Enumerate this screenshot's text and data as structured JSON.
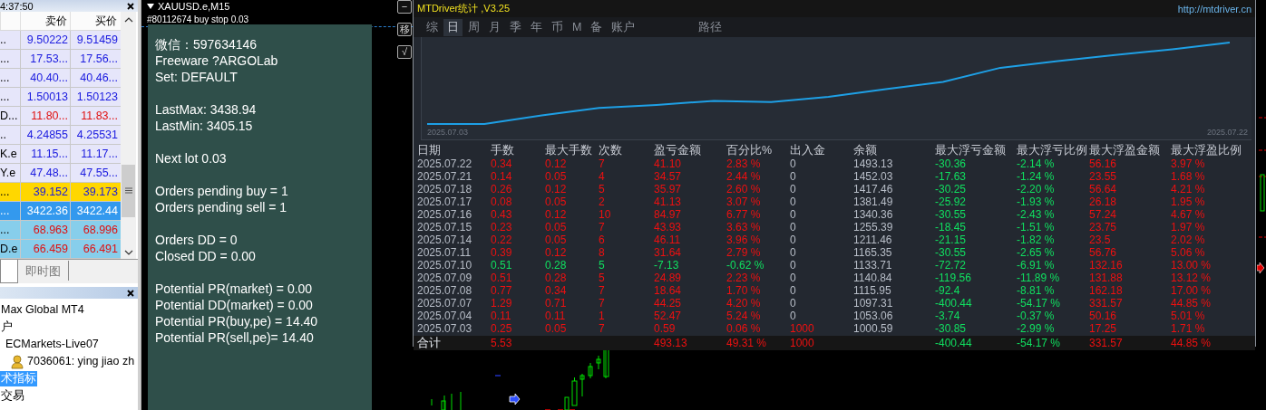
{
  "market_watch": {
    "time": "4:37:50",
    "columns": [
      "卖价",
      "买价"
    ],
    "rows": [
      {
        "symbol": "..",
        "bid": "9.50222",
        "ask": "9.51459",
        "falling": false,
        "color": "#e6e6fa",
        "selected": false
      },
      {
        "symbol": "...",
        "bid": "17.53...",
        "ask": "17.56...",
        "falling": false,
        "color": "#e6e6fa",
        "selected": false
      },
      {
        "symbol": "...",
        "bid": "40.40...",
        "ask": "40.46...",
        "falling": false,
        "color": "#e6e6fa",
        "selected": false
      },
      {
        "symbol": "...",
        "bid": "1.50013",
        "ask": "1.50123",
        "falling": false,
        "color": "#e6e6fa",
        "selected": false
      },
      {
        "symbol": "D...",
        "bid": "11.80...",
        "ask": "11.83...",
        "falling": true,
        "color": "#e6e6fa",
        "selected": false
      },
      {
        "symbol": "..",
        "bid": "4.24855",
        "ask": "4.25531",
        "falling": false,
        "color": "#e6e6fa",
        "selected": false
      },
      {
        "symbol": "K.e",
        "bid": "11.15...",
        "ask": "11.17...",
        "falling": false,
        "color": "#e6e6fa",
        "selected": false
      },
      {
        "symbol": "Y.e",
        "bid": "47.48...",
        "ask": "47.55...",
        "falling": false,
        "color": "#e6e6fa",
        "selected": false
      },
      {
        "symbol": "...",
        "bid": "39.152",
        "ask": "39.173",
        "falling": false,
        "color": "#ffd700",
        "selected": false
      },
      {
        "symbol": "...",
        "bid": "3422.36",
        "ask": "3422.44",
        "falling": false,
        "selected": true
      },
      {
        "symbol": "...",
        "bid": "68.963",
        "ask": "68.996",
        "falling": true,
        "color": "#87ceeb",
        "selected": false
      },
      {
        "symbol": "D.e",
        "bid": "66.459",
        "ask": "66.491",
        "falling": true,
        "color": "#87ceeb",
        "selected": false
      }
    ],
    "tabs": [
      {
        "label": "即时图",
        "selected": false
      }
    ]
  },
  "navigator": {
    "items": [
      {
        "label": "Max Global MT4",
        "selected": false
      },
      {
        "label": "户",
        "selected": false,
        "children": [
          {
            "label": "ECMarkets-Live07",
            "selected": false,
            "children": [
              {
                "label": "7036061: ying jiao zh",
                "kind": "account",
                "selected": false
              }
            ]
          }
        ]
      },
      {
        "label": "术指标",
        "selected": true
      },
      {
        "label": "交易",
        "selected": false
      }
    ]
  },
  "chart": {
    "title": "XAUUSD.e,M15",
    "order_label": "#80112674 buy stop 0.03",
    "side_buttons": [
      "−",
      "移",
      "√"
    ]
  },
  "info_panel": {
    "groups": [
      [
        "微信：597634146",
        "Freeware ?ARGOLab",
        "Set: DEFAULT"
      ],
      [
        "LastMax: 3438.94",
        "LastMin: 3405.15"
      ],
      [
        "Next lot 0.03"
      ],
      [
        "Orders pending buy =  1",
        "Orders pending sell = 1"
      ],
      [
        "Orders DD = 0",
        "Closed DD = 0.00"
      ],
      [
        "Potential PR(market) = 0.00",
        "Potential DD(market) = 0.00",
        "Potential PR(buy,pe) = 14.40",
        "Potential PR(sell,pe)= 14.40"
      ]
    ]
  },
  "stats": {
    "title": "MTDriver统计 ,V3.25",
    "link": "http://mtdriver.cn",
    "tabs": [
      {
        "label": "综",
        "selected": false
      },
      {
        "label": "日",
        "selected": true
      },
      {
        "label": "周",
        "selected": false
      },
      {
        "label": "月",
        "selected": false
      },
      {
        "label": "季",
        "selected": false
      },
      {
        "label": "年",
        "selected": false
      },
      {
        "label": "币",
        "selected": false
      },
      {
        "label": "M",
        "selected": false
      },
      {
        "label": "备",
        "selected": false
      },
      {
        "label": "账户",
        "selected": false
      }
    ],
    "path_tab": "路径",
    "balance_chart": {
      "start_label": "2025.07.03",
      "end_label": "2025.07.22"
    },
    "columns": [
      "日期",
      "手数",
      "最大手数",
      "次数",
      "盈亏金额",
      "百分比%",
      "出入金",
      "余额",
      "最大浮亏金额",
      "最大浮亏比例",
      "最大浮盈金额",
      "最大浮盈比例"
    ],
    "rows": [
      {
        "cells": [
          {
            "text": "2025.07.22",
            "color": "#b8bec8"
          },
          {
            "text": "0.34",
            "color": "#ee1010"
          },
          {
            "text": "0.12",
            "color": "#ee1010"
          },
          {
            "text": "7",
            "color": "#ee1010"
          },
          {
            "text": "41.10",
            "color": "#ee1010"
          },
          {
            "text": "2.83 %",
            "color": "#ee1010"
          },
          {
            "text": "0",
            "color": "#b8bec8"
          },
          {
            "text": "1493.13",
            "color": "#b8bec8"
          },
          {
            "text": "-30.36",
            "color": "#10e060"
          },
          {
            "text": "-2.14 %",
            "color": "#10e060"
          },
          {
            "text": "56.16",
            "color": "#ee1010"
          },
          {
            "text": "3.97 %",
            "color": "#ee1010"
          }
        ]
      },
      {
        "cells": [
          {
            "text": "2025.07.21",
            "color": "#b8bec8"
          },
          {
            "text": "0.14",
            "color": "#ee1010"
          },
          {
            "text": "0.05",
            "color": "#ee1010"
          },
          {
            "text": "4",
            "color": "#ee1010"
          },
          {
            "text": "34.57",
            "color": "#ee1010"
          },
          {
            "text": "2.44 %",
            "color": "#ee1010"
          },
          {
            "text": "0",
            "color": "#b8bec8"
          },
          {
            "text": "1452.03",
            "color": "#b8bec8"
          },
          {
            "text": "-17.63",
            "color": "#10e060"
          },
          {
            "text": "-1.24 %",
            "color": "#10e060"
          },
          {
            "text": "23.55",
            "color": "#ee1010"
          },
          {
            "text": "1.68 %",
            "color": "#ee1010"
          }
        ]
      },
      {
        "cells": [
          {
            "text": "2025.07.18",
            "color": "#b8bec8"
          },
          {
            "text": "0.26",
            "color": "#ee1010"
          },
          {
            "text": "0.12",
            "color": "#ee1010"
          },
          {
            "text": "5",
            "color": "#ee1010"
          },
          {
            "text": "35.97",
            "color": "#ee1010"
          },
          {
            "text": "2.60 %",
            "color": "#ee1010"
          },
          {
            "text": "0",
            "color": "#b8bec8"
          },
          {
            "text": "1417.46",
            "color": "#b8bec8"
          },
          {
            "text": "-30.25",
            "color": "#10e060"
          },
          {
            "text": "-2.20 %",
            "color": "#10e060"
          },
          {
            "text": "56.64",
            "color": "#ee1010"
          },
          {
            "text": "4.21 %",
            "color": "#ee1010"
          }
        ]
      },
      {
        "cells": [
          {
            "text": "2025.07.17",
            "color": "#b8bec8"
          },
          {
            "text": "0.08",
            "color": "#ee1010"
          },
          {
            "text": "0.05",
            "color": "#ee1010"
          },
          {
            "text": "2",
            "color": "#ee1010"
          },
          {
            "text": "41.13",
            "color": "#ee1010"
          },
          {
            "text": "3.07 %",
            "color": "#ee1010"
          },
          {
            "text": "0",
            "color": "#b8bec8"
          },
          {
            "text": "1381.49",
            "color": "#b8bec8"
          },
          {
            "text": "-25.92",
            "color": "#10e060"
          },
          {
            "text": "-1.93 %",
            "color": "#10e060"
          },
          {
            "text": "26.18",
            "color": "#ee1010"
          },
          {
            "text": "1.95 %",
            "color": "#ee1010"
          }
        ]
      },
      {
        "cells": [
          {
            "text": "2025.07.16",
            "color": "#b8bec8"
          },
          {
            "text": "0.43",
            "color": "#ee1010"
          },
          {
            "text": "0.12",
            "color": "#ee1010"
          },
          {
            "text": "10",
            "color": "#ee1010"
          },
          {
            "text": "84.97",
            "color": "#ee1010"
          },
          {
            "text": "6.77 %",
            "color": "#ee1010"
          },
          {
            "text": "0",
            "color": "#b8bec8"
          },
          {
            "text": "1340.36",
            "color": "#b8bec8"
          },
          {
            "text": "-30.55",
            "color": "#10e060"
          },
          {
            "text": "-2.43 %",
            "color": "#10e060"
          },
          {
            "text": "57.24",
            "color": "#ee1010"
          },
          {
            "text": "4.67 %",
            "color": "#ee1010"
          }
        ]
      },
      {
        "cells": [
          {
            "text": "2025.07.15",
            "color": "#b8bec8"
          },
          {
            "text": "0.23",
            "color": "#ee1010"
          },
          {
            "text": "0.05",
            "color": "#ee1010"
          },
          {
            "text": "7",
            "color": "#ee1010"
          },
          {
            "text": "43.93",
            "color": "#ee1010"
          },
          {
            "text": "3.63 %",
            "color": "#ee1010"
          },
          {
            "text": "0",
            "color": "#b8bec8"
          },
          {
            "text": "1255.39",
            "color": "#b8bec8"
          },
          {
            "text": "-18.45",
            "color": "#10e060"
          },
          {
            "text": "-1.51 %",
            "color": "#10e060"
          },
          {
            "text": "23.75",
            "color": "#ee1010"
          },
          {
            "text": "1.97 %",
            "color": "#ee1010"
          }
        ]
      },
      {
        "cells": [
          {
            "text": "2025.07.14",
            "color": "#b8bec8"
          },
          {
            "text": "0.22",
            "color": "#ee1010"
          },
          {
            "text": "0.05",
            "color": "#ee1010"
          },
          {
            "text": "6",
            "color": "#ee1010"
          },
          {
            "text": "46.11",
            "color": "#ee1010"
          },
          {
            "text": "3.96 %",
            "color": "#ee1010"
          },
          {
            "text": "0",
            "color": "#b8bec8"
          },
          {
            "text": "1211.46",
            "color": "#b8bec8"
          },
          {
            "text": "-21.15",
            "color": "#10e060"
          },
          {
            "text": "-1.82 %",
            "color": "#10e060"
          },
          {
            "text": "23.5",
            "color": "#ee1010"
          },
          {
            "text": "2.02 %",
            "color": "#ee1010"
          }
        ]
      },
      {
        "cells": [
          {
            "text": "2025.07.11",
            "color": "#b8bec8"
          },
          {
            "text": "0.39",
            "color": "#ee1010"
          },
          {
            "text": "0.12",
            "color": "#ee1010"
          },
          {
            "text": "8",
            "color": "#ee1010"
          },
          {
            "text": "31.64",
            "color": "#ee1010"
          },
          {
            "text": "2.79 %",
            "color": "#ee1010"
          },
          {
            "text": "0",
            "color": "#b8bec8"
          },
          {
            "text": "1165.35",
            "color": "#b8bec8"
          },
          {
            "text": "-30.55",
            "color": "#10e060"
          },
          {
            "text": "-2.65 %",
            "color": "#10e060"
          },
          {
            "text": "56.76",
            "color": "#ee1010"
          },
          {
            "text": "5.06 %",
            "color": "#ee1010"
          }
        ]
      },
      {
        "cells": [
          {
            "text": "2025.07.10",
            "color": "#b8bec8"
          },
          {
            "text": "0.51",
            "color": "#10e060"
          },
          {
            "text": "0.28",
            "color": "#10e060"
          },
          {
            "text": "5",
            "color": "#10e060"
          },
          {
            "text": "-7.13",
            "color": "#10e060"
          },
          {
            "text": "-0.62 %",
            "color": "#10e060"
          },
          {
            "text": "0",
            "color": "#b8bec8"
          },
          {
            "text": "1133.71",
            "color": "#b8bec8"
          },
          {
            "text": "-72.72",
            "color": "#10e060"
          },
          {
            "text": "-6.91 %",
            "color": "#10e060"
          },
          {
            "text": "132.16",
            "color": "#ee1010"
          },
          {
            "text": "13.00 %",
            "color": "#ee1010"
          }
        ]
      },
      {
        "cells": [
          {
            "text": "2025.07.09",
            "color": "#b8bec8"
          },
          {
            "text": "0.51",
            "color": "#ee1010"
          },
          {
            "text": "0.28",
            "color": "#ee1010"
          },
          {
            "text": "5",
            "color": "#ee1010"
          },
          {
            "text": "24.89",
            "color": "#ee1010"
          },
          {
            "text": "2.23 %",
            "color": "#ee1010"
          },
          {
            "text": "0",
            "color": "#b8bec8"
          },
          {
            "text": "1140.84",
            "color": "#b8bec8"
          },
          {
            "text": "-119.56",
            "color": "#10e060"
          },
          {
            "text": "-11.89 %",
            "color": "#10e060"
          },
          {
            "text": "131.88",
            "color": "#ee1010"
          },
          {
            "text": "13.12 %",
            "color": "#ee1010"
          }
        ]
      },
      {
        "cells": [
          {
            "text": "2025.07.08",
            "color": "#b8bec8"
          },
          {
            "text": "0.77",
            "color": "#ee1010"
          },
          {
            "text": "0.34",
            "color": "#ee1010"
          },
          {
            "text": "7",
            "color": "#ee1010"
          },
          {
            "text": "18.64",
            "color": "#ee1010"
          },
          {
            "text": "1.70 %",
            "color": "#ee1010"
          },
          {
            "text": "0",
            "color": "#b8bec8"
          },
          {
            "text": "1115.95",
            "color": "#b8bec8"
          },
          {
            "text": "-92.4",
            "color": "#10e060"
          },
          {
            "text": "-8.81 %",
            "color": "#10e060"
          },
          {
            "text": "162.18",
            "color": "#ee1010"
          },
          {
            "text": "17.00 %",
            "color": "#ee1010"
          }
        ]
      },
      {
        "cells": [
          {
            "text": "2025.07.07",
            "color": "#b8bec8"
          },
          {
            "text": "1.29",
            "color": "#ee1010"
          },
          {
            "text": "0.71",
            "color": "#ee1010"
          },
          {
            "text": "7",
            "color": "#ee1010"
          },
          {
            "text": "44.25",
            "color": "#ee1010"
          },
          {
            "text": "4.20 %",
            "color": "#ee1010"
          },
          {
            "text": "0",
            "color": "#b8bec8"
          },
          {
            "text": "1097.31",
            "color": "#b8bec8"
          },
          {
            "text": "-400.44",
            "color": "#10e060"
          },
          {
            "text": "-54.17 %",
            "color": "#10e060"
          },
          {
            "text": "331.57",
            "color": "#ee1010"
          },
          {
            "text": "44.85 %",
            "color": "#ee1010"
          }
        ]
      },
      {
        "cells": [
          {
            "text": "2025.07.04",
            "color": "#b8bec8"
          },
          {
            "text": "0.11",
            "color": "#ee1010"
          },
          {
            "text": "0.11",
            "color": "#ee1010"
          },
          {
            "text": "1",
            "color": "#ee1010"
          },
          {
            "text": "52.47",
            "color": "#ee1010"
          },
          {
            "text": "5.24 %",
            "color": "#ee1010"
          },
          {
            "text": "0",
            "color": "#b8bec8"
          },
          {
            "text": "1053.06",
            "color": "#b8bec8"
          },
          {
            "text": "-3.74",
            "color": "#10e060"
          },
          {
            "text": "-0.37 %",
            "color": "#10e060"
          },
          {
            "text": "50.16",
            "color": "#ee1010"
          },
          {
            "text": "5.01 %",
            "color": "#ee1010"
          }
        ]
      },
      {
        "cells": [
          {
            "text": "2025.07.03",
            "color": "#b8bec8"
          },
          {
            "text": "0.25",
            "color": "#ee1010"
          },
          {
            "text": "0.05",
            "color": "#ee1010"
          },
          {
            "text": "7",
            "color": "#ee1010"
          },
          {
            "text": "0.59",
            "color": "#ee1010"
          },
          {
            "text": "0.06 %",
            "color": "#ee1010"
          },
          {
            "text": "1000",
            "color": "#ee1010"
          },
          {
            "text": "1000.59",
            "color": "#b8bec8"
          },
          {
            "text": "-30.85",
            "color": "#10e060"
          },
          {
            "text": "-2.99 %",
            "color": "#10e060"
          },
          {
            "text": "17.25",
            "color": "#ee1010"
          },
          {
            "text": "1.71 %",
            "color": "#ee1010"
          }
        ]
      }
    ],
    "totals": {
      "label": {
        "text": "合计"
      },
      "lots": {
        "text": "5.53",
        "color": "#ee1010"
      },
      "profit": {
        "text": "493.13",
        "color": "#ee1010"
      },
      "percent": {
        "text": "49.31 %",
        "color": "#ee1010"
      },
      "deposit": {
        "text": "1000",
        "color": "#ee1010"
      },
      "max_loss": {
        "text": "-400.44",
        "color": "#10e060"
      },
      "max_loss_ratio": {
        "text": "-54.17 %",
        "color": "#10e060"
      },
      "max_gain": {
        "text": "331.57",
        "color": "#ee1010"
      },
      "max_gain_ratio": {
        "text": "44.85 %",
        "color": "#ee1010"
      }
    }
  }
}
